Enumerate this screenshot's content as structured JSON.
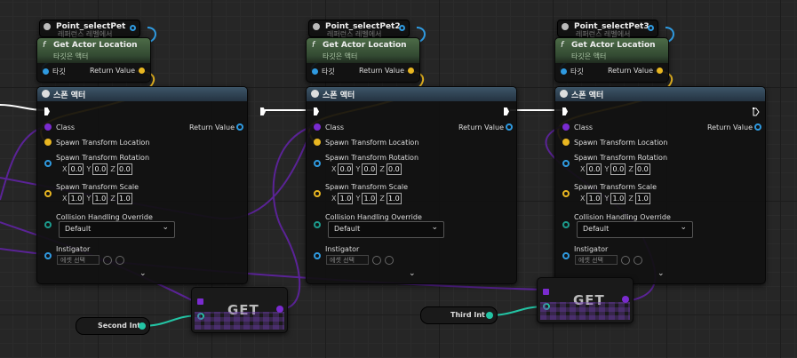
{
  "variables": [
    {
      "name": "Point_selectPet",
      "sub": "레퍼런스 레벨에서"
    },
    {
      "name": "Point_selectPet2",
      "sub": "레퍼런스 레벨에서"
    },
    {
      "name": "Point_selectPet3",
      "sub": "레퍼런스 레벨에서"
    }
  ],
  "get_actor_location": {
    "icon": "f",
    "title": "Get Actor Location",
    "subtitle": "타깃은 액터",
    "target_label": "타깃",
    "return_label": "Return Value"
  },
  "spawn_actor": {
    "title": "스폰 액터",
    "class_label": "Class",
    "return_label": "Return Value",
    "location_label": "Spawn Transform Location",
    "rotation_label": "Spawn Transform Rotation",
    "scale_label": "Spawn Transform Scale",
    "rotation": {
      "x": "0.0",
      "y": "0.0",
      "z": "0.0"
    },
    "scale": {
      "x": "1.0",
      "y": "1.0",
      "z": "1.0"
    },
    "collision_label": "Collision Handling Override",
    "collision_value": "Default",
    "instigator_label": "Instigator",
    "instigator_value": "에셋 선택",
    "axis_x": "X",
    "axis_y": "Y",
    "axis_z": "Z",
    "chevron": "⌄"
  },
  "get_nodes": [
    {
      "label": "GET"
    },
    {
      "label": "GET"
    }
  ],
  "int_vars": [
    {
      "name": "Second Int"
    },
    {
      "name": "Third Int"
    }
  ],
  "colors": {
    "exec": "#ffffff",
    "object_pin": "#2f9ae0",
    "vector_pin": "#e8b621",
    "class_pin": "#7a2bcf",
    "int_pin": "#23c4a4",
    "function_header": "#4c6b47",
    "spawn_header": "#3d5568"
  }
}
